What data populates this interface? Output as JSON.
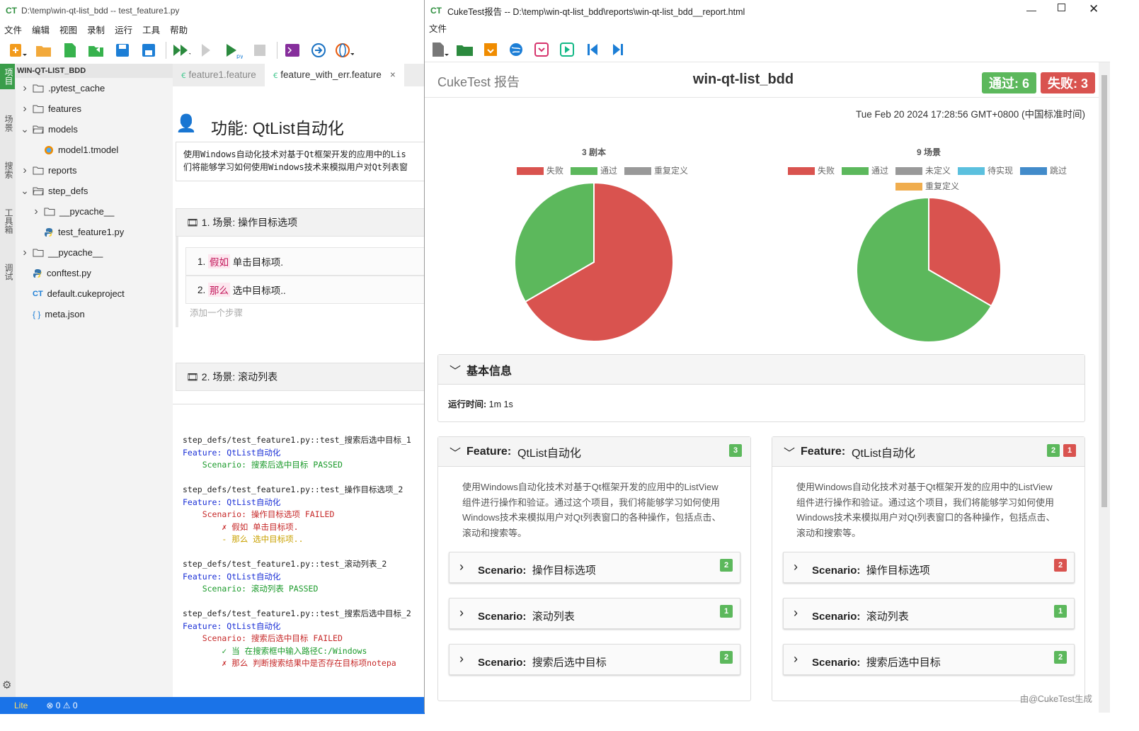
{
  "ide": {
    "app_icon": "CT",
    "title": "D:\\temp\\win-qt-list_bdd -- test_feature1.py",
    "menu": [
      "文件",
      "编辑",
      "视图",
      "录制",
      "运行",
      "工具",
      "帮助"
    ],
    "activity": [
      "项目",
      "场景",
      "搜索",
      "工具箱",
      "调试"
    ],
    "explorer": {
      "header": "WIN-QT-LIST_BDD",
      "items": [
        {
          "label": ".pytest_cache",
          "type": "folder",
          "expanded": false,
          "indent": 0
        },
        {
          "label": "features",
          "type": "folder",
          "expanded": false,
          "indent": 0
        },
        {
          "label": "models",
          "type": "folder",
          "expanded": true,
          "indent": 0
        },
        {
          "label": "model1.tmodel",
          "type": "tmodel",
          "indent": 1
        },
        {
          "label": "reports",
          "type": "folder",
          "expanded": false,
          "indent": 0
        },
        {
          "label": "step_defs",
          "type": "folder",
          "expanded": true,
          "indent": 0
        },
        {
          "label": "__pycache__",
          "type": "folder",
          "expanded": false,
          "indent": 1
        },
        {
          "label": "test_feature1.py",
          "type": "python",
          "indent": 1
        },
        {
          "label": "__pycache__",
          "type": "folder",
          "expanded": false,
          "indent": 0
        },
        {
          "label": "conftest.py",
          "type": "python",
          "indent": 0
        },
        {
          "label": "default.cukeproject",
          "type": "ct",
          "indent": 0
        },
        {
          "label": "meta.json",
          "type": "json",
          "indent": 0
        }
      ]
    },
    "tabs": [
      {
        "label": "feature1.feature",
        "active": false
      },
      {
        "label": "feature_with_err.feature",
        "active": true,
        "close": "×"
      }
    ],
    "editor": {
      "feature_title": "功能: QtList自动化",
      "description_line1": "使用Windows自动化技术对基于Qt框架开发的应用中的Lis",
      "description_line2": "们将能够学习如何使用Windows技术来模拟用户对Qt列表窗",
      "scenario1_title": "1. 场景: 操作目标选项",
      "step1_num": "1.",
      "step1_kw": "假如",
      "step1_text": "单击目标项.",
      "step2_num": "2.",
      "step2_kw": "那么",
      "step2_text": "选中目标项..",
      "add_step": "添加一个步骤",
      "scenario2_title": "2. 场景: 滚动列表"
    },
    "output": [
      {
        "text": "step_defs/test_feature1.py::test_搜索后选中目标_1",
        "color": "#222"
      },
      {
        "text": "Feature: QtList自动化",
        "color": "#1a2fd6"
      },
      {
        "text": "    Scenario: 搜索后选中目标 PASSED",
        "color": "#1a9a2a"
      },
      {
        "text": "",
        "color": "#222"
      },
      {
        "text": "step_defs/test_feature1.py::test_操作目标选项_2",
        "color": "#222"
      },
      {
        "text": "Feature: QtList自动化",
        "color": "#1a2fd6"
      },
      {
        "text": "    Scenario: 操作目标选项 FAILED",
        "color": "#c62828"
      },
      {
        "text": "        ✗ 假如 单击目标项.",
        "color": "#c62828"
      },
      {
        "text": "        - 那么 选中目标项..",
        "color": "#c9a100"
      },
      {
        "text": "",
        "color": "#222"
      },
      {
        "text": "step_defs/test_feature1.py::test_滚动列表_2",
        "color": "#222"
      },
      {
        "text": "Feature: QtList自动化",
        "color": "#1a2fd6"
      },
      {
        "text": "    Scenario: 滚动列表 PASSED",
        "color": "#1a9a2a"
      },
      {
        "text": "",
        "color": "#222"
      },
      {
        "text": "step_defs/test_feature1.py::test_搜索后选中目标_2",
        "color": "#222"
      },
      {
        "text": "Feature: QtList自动化",
        "color": "#1a2fd6"
      },
      {
        "text": "    Scenario: 搜索后选中目标 FAILED",
        "color": "#c62828"
      },
      {
        "text": "        ✓ 当 在搜索框中输入路径C:/Windows",
        "color": "#1a9a2a"
      },
      {
        "text": "        ✗ 那么 判断搜索结果中是否存在目标项notepa",
        "color": "#c62828"
      }
    ],
    "status": {
      "mode": "Lite",
      "errors": "0",
      "warnings": "0"
    }
  },
  "report_window": {
    "app_icon": "CT",
    "title": "CukeTest报告 -- D:\\temp\\win-qt-list_bdd\\reports\\win-qt-list_bdd__report.html",
    "menu": [
      "文件"
    ],
    "header_left": "CukeTest 报告",
    "header_title": "win-qt-list_bdd",
    "pass_label": "通过: 6",
    "fail_label": "失败: 3",
    "timestamp": "Tue Feb 20 2024 17:28:56 GMT+0800 (中国标准时间)",
    "basic_info_title": "基本信息",
    "run_time_label": "运行时间:",
    "run_time_value": "1m 1s",
    "footer": "由@CukeTest生成",
    "colors": {
      "fail": "#d9534f",
      "pass": "#5cb85c",
      "undefined": "#999999",
      "pending": "#5bc0de",
      "skipped": "#428bca",
      "ambiguous": "#f0ad4e"
    }
  },
  "features": [
    {
      "label": "Feature:",
      "name": "QtList自动化",
      "description": [
        "使用Windows自动化技术对基于Qt框架开发的应用中的ListView",
        "组件进行操作和验证。通过这个项目，我们将能够学习如何使用",
        "Windows技术来模拟用户对Qt列表窗口的各种操作，包括点击、",
        "滚动和搜索等。"
      ],
      "badges": [
        {
          "value": "3",
          "color": "#5cb85c"
        }
      ],
      "scenarios": [
        {
          "label": "Scenario:",
          "name": "操作目标选项",
          "badge": "2",
          "color": "#5cb85c"
        },
        {
          "label": "Scenario:",
          "name": "滚动列表",
          "badge": "1",
          "color": "#5cb85c"
        },
        {
          "label": "Scenario:",
          "name": "搜索后选中目标",
          "badge": "2",
          "color": "#5cb85c"
        }
      ]
    },
    {
      "label": "Feature:",
      "name": "QtList自动化",
      "description": [
        "使用Windows自动化技术对基于Qt框架开发的应用中的ListView",
        "组件进行操作和验证。通过这个项目，我们将能够学习如何使用",
        "Windows技术来模拟用户对Qt列表窗口的各种操作，包括点击、",
        "滚动和搜索等。"
      ],
      "badges": [
        {
          "value": "2",
          "color": "#5cb85c"
        },
        {
          "value": "1",
          "color": "#d9534f"
        }
      ],
      "scenarios": [
        {
          "label": "Scenario:",
          "name": "操作目标选项",
          "badge": "2",
          "color": "#d9534f"
        },
        {
          "label": "Scenario:",
          "name": "滚动列表",
          "badge": "1",
          "color": "#5cb85c"
        },
        {
          "label": "Scenario:",
          "name": "搜索后选中目标",
          "badge": "2",
          "color": "#5cb85c"
        }
      ]
    }
  ],
  "chart_data": [
    {
      "type": "pie",
      "title": "3 剧本",
      "legend": [
        {
          "name": "失败",
          "color": "#d9534f"
        },
        {
          "name": "通过",
          "color": "#5cb85c"
        },
        {
          "name": "重复定义",
          "color": "#999999"
        }
      ],
      "slices": [
        {
          "name": "失败",
          "value": 2,
          "color": "#d9534f"
        },
        {
          "name": "通过",
          "value": 1,
          "color": "#5cb85c"
        }
      ]
    },
    {
      "type": "pie",
      "title": "9 场景",
      "legend": [
        {
          "name": "失败",
          "color": "#d9534f"
        },
        {
          "name": "通过",
          "color": "#5cb85c"
        },
        {
          "name": "未定义",
          "color": "#999999"
        },
        {
          "name": "待实现",
          "color": "#5bc0de"
        },
        {
          "name": "跳过",
          "color": "#428bca"
        },
        {
          "name": "重复定义",
          "color": "#f0ad4e"
        }
      ],
      "slices": [
        {
          "name": "失败",
          "value": 3,
          "color": "#d9534f"
        },
        {
          "name": "通过",
          "value": 6,
          "color": "#5cb85c"
        }
      ]
    }
  ]
}
